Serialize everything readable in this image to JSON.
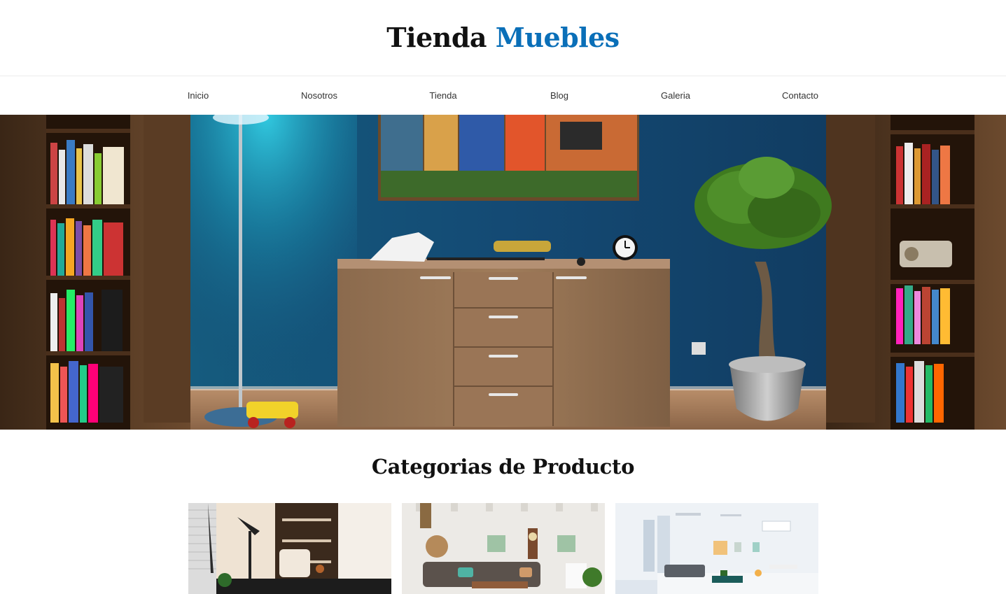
{
  "header": {
    "logo_part1": "Tienda",
    "logo_part2": "Muebles"
  },
  "nav": {
    "items": [
      "Inicio",
      "Nosotros",
      "Tienda",
      "Blog",
      "Galeria",
      "Contacto"
    ]
  },
  "section": {
    "title": "Categorias de Producto"
  },
  "colors": {
    "accent": "#0a6fb8",
    "text_dark": "#111111",
    "nav_text": "#333333"
  }
}
